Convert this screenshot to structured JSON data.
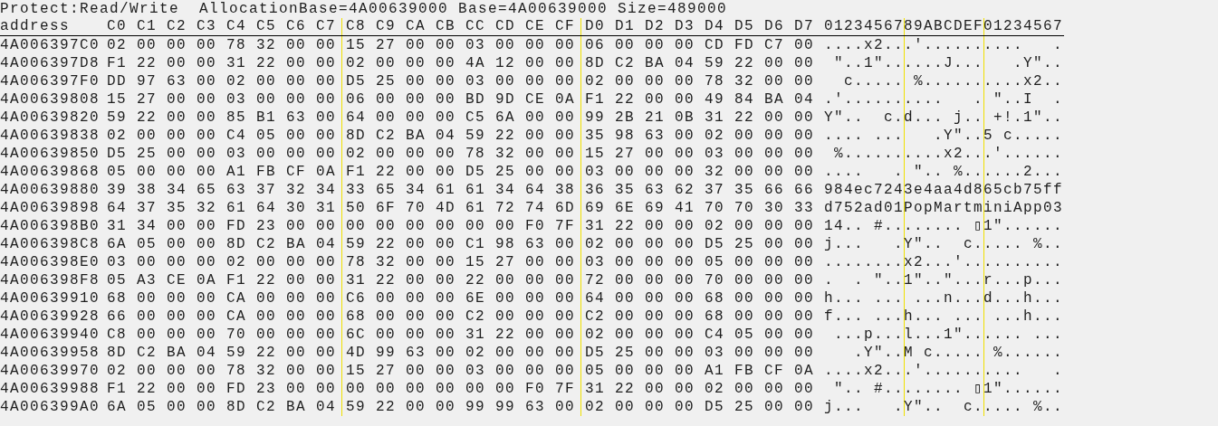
{
  "info": [
    "Protect:Read/Write",
    "AllocationBase=4A00639000",
    "Base=4A00639000",
    "Size=489000"
  ],
  "columns": {
    "address": "address",
    "bytes": [
      "C0",
      "C1",
      "C2",
      "C3",
      "C4",
      "C5",
      "C6",
      "C7",
      "C8",
      "C9",
      "CA",
      "CB",
      "CC",
      "CD",
      "CE",
      "CF",
      "D0",
      "D1",
      "D2",
      "D3",
      "D4",
      "D5",
      "D6",
      "D7"
    ],
    "ascii": "0123456789ABCDEF01234567"
  },
  "rows": [
    {
      "address": "4A006397C0",
      "bytes": [
        "02",
        "00",
        "00",
        "00",
        "78",
        "32",
        "00",
        "00",
        "15",
        "27",
        "00",
        "00",
        "03",
        "00",
        "00",
        "00",
        "06",
        "00",
        "00",
        "00",
        "CD",
        "FD",
        "C7",
        "00"
      ],
      "ascii": "....x2...'..........   ."
    },
    {
      "address": "4A006397D8",
      "bytes": [
        "F1",
        "22",
        "00",
        "00",
        "31",
        "22",
        "00",
        "00",
        "02",
        "00",
        "00",
        "00",
        "4A",
        "12",
        "00",
        "00",
        "8D",
        "C2",
        "BA",
        "04",
        "59",
        "22",
        "00",
        "00"
      ],
      "ascii": " \"..1\"......J...   .Y\".."
    },
    {
      "address": "4A006397F0",
      "bytes": [
        "DD",
        "97",
        "63",
        "00",
        "02",
        "00",
        "00",
        "00",
        "D5",
        "25",
        "00",
        "00",
        "03",
        "00",
        "00",
        "00",
        "02",
        "00",
        "00",
        "00",
        "78",
        "32",
        "00",
        "00"
      ],
      "ascii": "  c..... %..........x2.."
    },
    {
      "address": "4A00639808",
      "bytes": [
        "15",
        "27",
        "00",
        "00",
        "03",
        "00",
        "00",
        "00",
        "06",
        "00",
        "00",
        "00",
        "BD",
        "9D",
        "CE",
        "0A",
        "F1",
        "22",
        "00",
        "00",
        "49",
        "84",
        "BA",
        "04"
      ],
      "ascii": ".'..........   . \"..I  ."
    },
    {
      "address": "4A00639820",
      "bytes": [
        "59",
        "22",
        "00",
        "00",
        "85",
        "B1",
        "63",
        "00",
        "64",
        "00",
        "00",
        "00",
        "C5",
        "6A",
        "00",
        "00",
        "99",
        "2B",
        "21",
        "0B",
        "31",
        "22",
        "00",
        "00"
      ],
      "ascii": "Y\"..  c.d... j.. +!.1\".."
    },
    {
      "address": "4A00639838",
      "bytes": [
        "02",
        "00",
        "00",
        "00",
        "C4",
        "05",
        "00",
        "00",
        "8D",
        "C2",
        "BA",
        "04",
        "59",
        "22",
        "00",
        "00",
        "35",
        "98",
        "63",
        "00",
        "02",
        "00",
        "00",
        "00"
      ],
      "ascii": ".... ...   .Y\"..5 c....."
    },
    {
      "address": "4A00639850",
      "bytes": [
        "D5",
        "25",
        "00",
        "00",
        "03",
        "00",
        "00",
        "00",
        "02",
        "00",
        "00",
        "00",
        "78",
        "32",
        "00",
        "00",
        "15",
        "27",
        "00",
        "00",
        "03",
        "00",
        "00",
        "00"
      ],
      "ascii": " %..........x2...'......"
    },
    {
      "address": "4A00639868",
      "bytes": [
        "05",
        "00",
        "00",
        "00",
        "A1",
        "FB",
        "CF",
        "0A",
        "F1",
        "22",
        "00",
        "00",
        "D5",
        "25",
        "00",
        "00",
        "03",
        "00",
        "00",
        "00",
        "32",
        "00",
        "00",
        "00"
      ],
      "ascii": "....   . \".. %......2..."
    },
    {
      "address": "4A00639880",
      "bytes": [
        "39",
        "38",
        "34",
        "65",
        "63",
        "37",
        "32",
        "34",
        "33",
        "65",
        "34",
        "61",
        "61",
        "34",
        "64",
        "38",
        "36",
        "35",
        "63",
        "62",
        "37",
        "35",
        "66",
        "66"
      ],
      "ascii": "984ec7243e4aa4d865cb75ff"
    },
    {
      "address": "4A00639898",
      "bytes": [
        "64",
        "37",
        "35",
        "32",
        "61",
        "64",
        "30",
        "31",
        "50",
        "6F",
        "70",
        "4D",
        "61",
        "72",
        "74",
        "6D",
        "69",
        "6E",
        "69",
        "41",
        "70",
        "70",
        "30",
        "33"
      ],
      "ascii": "d752ad01PopMartminiApp03"
    },
    {
      "address": "4A006398B0",
      "bytes": [
        "31",
        "34",
        "00",
        "00",
        "FD",
        "23",
        "00",
        "00",
        "00",
        "00",
        "00",
        "00",
        "00",
        "00",
        "F0",
        "7F",
        "31",
        "22",
        "00",
        "00",
        "02",
        "00",
        "00",
        "00"
      ],
      "ascii": "14.. #........ ▯1\"......"
    },
    {
      "address": "4A006398C8",
      "bytes": [
        "6A",
        "05",
        "00",
        "00",
        "8D",
        "C2",
        "BA",
        "04",
        "59",
        "22",
        "00",
        "00",
        "C1",
        "98",
        "63",
        "00",
        "02",
        "00",
        "00",
        "00",
        "D5",
        "25",
        "00",
        "00"
      ],
      "ascii": "j...   .Y\"..  c..... %.."
    },
    {
      "address": "4A006398E0",
      "bytes": [
        "03",
        "00",
        "00",
        "00",
        "02",
        "00",
        "00",
        "00",
        "78",
        "32",
        "00",
        "00",
        "15",
        "27",
        "00",
        "00",
        "03",
        "00",
        "00",
        "00",
        "05",
        "00",
        "00",
        "00"
      ],
      "ascii": "........x2...'.........."
    },
    {
      "address": "4A006398F8",
      "bytes": [
        "05",
        "A3",
        "CE",
        "0A",
        "F1",
        "22",
        "00",
        "00",
        "31",
        "22",
        "00",
        "00",
        "22",
        "00",
        "00",
        "00",
        "72",
        "00",
        "00",
        "00",
        "70",
        "00",
        "00",
        "00"
      ],
      "ascii": ".  . \"..1\"..\"...r...p..."
    },
    {
      "address": "4A00639910",
      "bytes": [
        "68",
        "00",
        "00",
        "00",
        "CA",
        "00",
        "00",
        "00",
        "C6",
        "00",
        "00",
        "00",
        "6E",
        "00",
        "00",
        "00",
        "64",
        "00",
        "00",
        "00",
        "68",
        "00",
        "00",
        "00"
      ],
      "ascii": "h... ... ...n...d...h..."
    },
    {
      "address": "4A00639928",
      "bytes": [
        "66",
        "00",
        "00",
        "00",
        "CA",
        "00",
        "00",
        "00",
        "68",
        "00",
        "00",
        "00",
        "C2",
        "00",
        "00",
        "00",
        "C2",
        "00",
        "00",
        "00",
        "68",
        "00",
        "00",
        "00"
      ],
      "ascii": "f... ...h... ... ...h..."
    },
    {
      "address": "4A00639940",
      "bytes": [
        "C8",
        "00",
        "00",
        "00",
        "70",
        "00",
        "00",
        "00",
        "6C",
        "00",
        "00",
        "00",
        "31",
        "22",
        "00",
        "00",
        "02",
        "00",
        "00",
        "00",
        "C4",
        "05",
        "00",
        "00"
      ],
      "ascii": " ...p...l...1\"...... ..."
    },
    {
      "address": "4A00639958",
      "bytes": [
        "8D",
        "C2",
        "BA",
        "04",
        "59",
        "22",
        "00",
        "00",
        "4D",
        "99",
        "63",
        "00",
        "02",
        "00",
        "00",
        "00",
        "D5",
        "25",
        "00",
        "00",
        "03",
        "00",
        "00",
        "00"
      ],
      "ascii": "   .Y\"..M c..... %......"
    },
    {
      "address": "4A00639970",
      "bytes": [
        "02",
        "00",
        "00",
        "00",
        "78",
        "32",
        "00",
        "00",
        "15",
        "27",
        "00",
        "00",
        "03",
        "00",
        "00",
        "00",
        "05",
        "00",
        "00",
        "00",
        "A1",
        "FB",
        "CF",
        "0A"
      ],
      "ascii": "....x2...'..........   ."
    },
    {
      "address": "4A00639988",
      "bytes": [
        "F1",
        "22",
        "00",
        "00",
        "FD",
        "23",
        "00",
        "00",
        "00",
        "00",
        "00",
        "00",
        "00",
        "00",
        "F0",
        "7F",
        "31",
        "22",
        "00",
        "00",
        "02",
        "00",
        "00",
        "00"
      ],
      "ascii": " \".. #........ ▯1\"......"
    },
    {
      "address": "4A006399A0",
      "bytes": [
        "6A",
        "05",
        "00",
        "00",
        "8D",
        "C2",
        "BA",
        "04",
        "59",
        "22",
        "00",
        "00",
        "99",
        "99",
        "63",
        "00",
        "02",
        "00",
        "00",
        "00",
        "D5",
        "25",
        "00",
        "00"
      ],
      "ascii": "j...   .Y\"..  c..... %.."
    }
  ]
}
